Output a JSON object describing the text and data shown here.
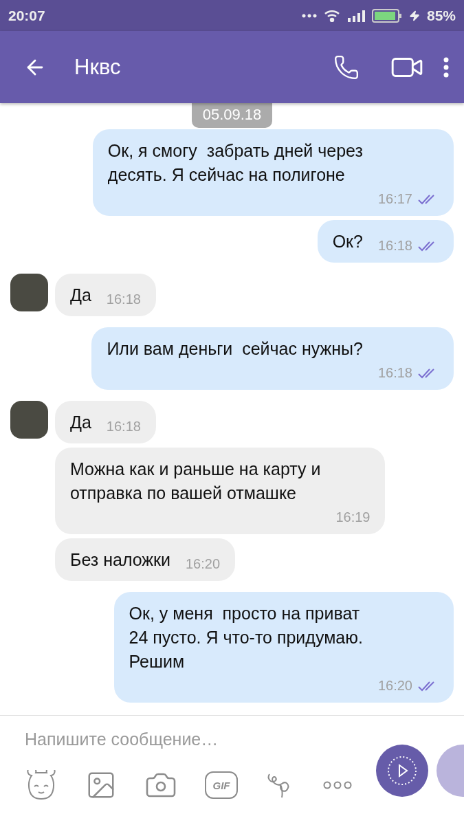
{
  "status_bar": {
    "time": "20:07",
    "battery": "85%"
  },
  "header": {
    "title": "Нквс"
  },
  "date_chip": "05.09.18",
  "messages": [
    {
      "kind": "out",
      "text": "Ок, я смогу  забрать дней через\nдесять. Я сейчас на полигоне",
      "time": "16:17",
      "read": true
    },
    {
      "kind": "out",
      "text": "Ок?",
      "time": "16:18",
      "read": true
    },
    {
      "kind": "in",
      "avatar": true,
      "text": "Да",
      "time": "16:18"
    },
    {
      "kind": "out",
      "text": "Или вам деньги  сейчас нужны?",
      "time": "16:18",
      "read": true
    },
    {
      "kind": "in",
      "avatar": true,
      "text": "Да",
      "time": "16:18"
    },
    {
      "kind": "in",
      "avatar": false,
      "text": "Можна как и раньше на карту и\nотправка по вашей отмашке",
      "time": "16:19"
    },
    {
      "kind": "in",
      "avatar": false,
      "text": "Без наложки",
      "time": "16:20"
    },
    {
      "kind": "out",
      "text": "Ок, у меня  просто на приват\n24 пусто. Я что-то придумаю.\nРешим",
      "time": "16:20",
      "read": true
    }
  ],
  "composer": {
    "placeholder": "Напишите сообщение…",
    "gif_label": "GIF"
  }
}
